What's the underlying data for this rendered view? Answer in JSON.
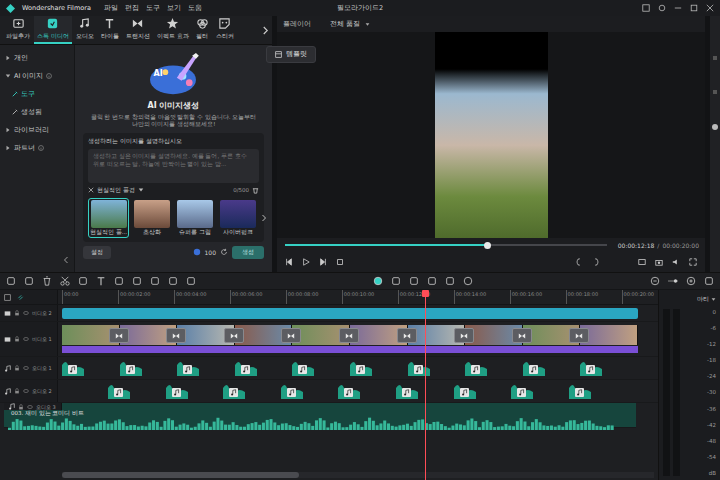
{
  "window": {
    "app_name": "Wondershare Filmora",
    "title": "필모라가이드2",
    "menu": [
      "파일",
      "편집",
      "도구",
      "보기",
      "도움"
    ]
  },
  "toolbar": [
    {
      "label": "파일추가",
      "selected": false
    },
    {
      "label": "스톡 미디어",
      "selected": true
    },
    {
      "label": "오디오",
      "selected": false
    },
    {
      "label": "타이틀",
      "selected": false
    },
    {
      "label": "트랜지션",
      "selected": false
    },
    {
      "label": "이펙트 효과",
      "selected": false
    },
    {
      "label": "필터",
      "selected": false
    },
    {
      "label": "스티커",
      "selected": false
    }
  ],
  "tooltip": "템플릿",
  "sidebar": [
    {
      "label": "개인",
      "kind": "group",
      "expanded": false,
      "info": false,
      "selected": false
    },
    {
      "label": "AI 이미지",
      "kind": "group",
      "expanded": true,
      "info": true,
      "selected": false
    },
    {
      "label": "도구",
      "kind": "item",
      "expanded": false,
      "info": false,
      "selected": true
    },
    {
      "label": "생성됨",
      "kind": "item",
      "expanded": false,
      "info": false,
      "selected": false
    },
    {
      "label": "라이브러리",
      "kind": "group",
      "expanded": false,
      "info": false,
      "selected": false
    },
    {
      "label": "파트너",
      "kind": "group",
      "expanded": false,
      "info": true,
      "selected": false
    }
  ],
  "ai_panel": {
    "badge": "AI",
    "title": "AI 이미지생성",
    "description": "클릭 한 번으로 창의력을 마음껏 발휘할 수 있습니다. 오늘부터 나만의 이미지를 생성해보세요!",
    "prompt_label": "생성하려는 이미지를 설명하십시오",
    "placeholder": "생성하고 싶은 이미지를 설명하세요. 예를 들어, 푸른 호수 위로 떠오르는 달, 하늘에 반짝이는 별이 있는 밤...",
    "style": "현실적인 풍경",
    "count": "0/500",
    "styles": [
      {
        "label": "현실적인 풍...",
        "selected": true
      },
      {
        "label": "초상화",
        "selected": false
      },
      {
        "label": "슈퍼롱 그림",
        "selected": false
      },
      {
        "label": "사이버펑크",
        "selected": false
      }
    ],
    "settings": "설정",
    "credits": "100",
    "generate": "생성"
  },
  "player": {
    "label": "플레이어",
    "quality": "전체 품질",
    "current": "00:00:12:18",
    "separator": "/",
    "total": "00:00:20:00",
    "level": 0.63
  },
  "timeline": {
    "ruler": [
      "00:00",
      "00:00:02:00",
      "00:00:04:00",
      "00:00:06:00",
      "00:00:08:00",
      "00:00:10:00",
      "00:00:12:00",
      "00:00:14:00",
      "00:00:16:00",
      "00:00:18:00",
      "00:00:20:00"
    ],
    "playhead": 0.635,
    "tracks": [
      {
        "name": "비디오 2",
        "kind": "overlay",
        "clips": []
      },
      {
        "name": "비디오 1",
        "kind": "video",
        "clips": [
          {
            "kind": "video"
          },
          {
            "kind": "video"
          },
          {
            "kind": "video"
          },
          {
            "kind": "video"
          },
          {
            "kind": "video"
          },
          {
            "kind": "video"
          },
          {
            "kind": "video"
          },
          {
            "kind": "video"
          },
          {
            "kind": "video"
          },
          {
            "kind": "video"
          }
        ]
      },
      {
        "name": "오디오 1",
        "kind": "sfx",
        "clips": [
          {
            "kind": "sfx"
          },
          {
            "kind": "sfx"
          },
          {
            "kind": "sfx"
          },
          {
            "kind": "sfx"
          },
          {
            "kind": "sfx"
          },
          {
            "kind": "sfx"
          },
          {
            "kind": "sfx"
          },
          {
            "kind": "sfx"
          },
          {
            "kind": "sfx"
          },
          {
            "kind": "sfx"
          }
        ]
      },
      {
        "name": "오디오 2",
        "kind": "sfx2",
        "clips": [
          {
            "kind": "sfx"
          },
          {
            "kind": "sfx"
          },
          {
            "kind": "sfx"
          },
          {
            "kind": "sfx"
          },
          {
            "kind": "sfx"
          },
          {
            "kind": "sfx"
          },
          {
            "kind": "sfx"
          },
          {
            "kind": "sfx"
          },
          {
            "kind": "sfx"
          }
        ]
      },
      {
        "name": "오디오 3",
        "kind": "music",
        "title": "003. 재미 있는 코미디 비트",
        "clips": []
      }
    ],
    "meter": {
      "label": "마티",
      "scale": [
        "0",
        "-6",
        "-12",
        "-18",
        "-24",
        "-30",
        "-36",
        "-42",
        "-48",
        "-54",
        "dB"
      ],
      "levels": [
        0,
        0
      ]
    }
  }
}
